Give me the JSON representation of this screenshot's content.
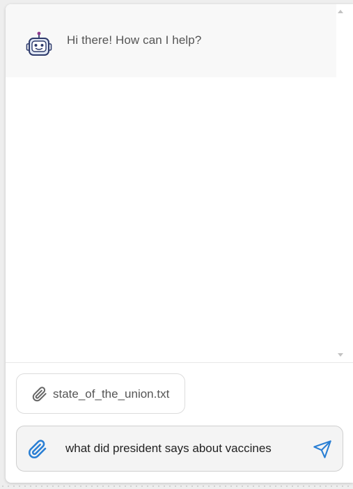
{
  "bot_message": {
    "text": "Hi there! How can I help?",
    "avatar_icon": "robot-icon"
  },
  "attachment": {
    "icon": "paperclip-icon",
    "file_name": "state_of_the_union.txt"
  },
  "composer": {
    "attach_icon": "paperclip-icon",
    "input_value": "what did president says about vaccines",
    "send_icon": "paper-plane-icon"
  },
  "colors": {
    "accent": "#2a7fd4",
    "robot": "#2d3a6b",
    "robot_accent": "#8e3b8e"
  }
}
